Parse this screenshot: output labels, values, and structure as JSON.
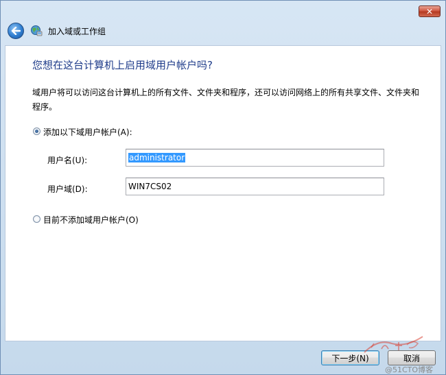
{
  "window": {
    "close_glyph": "✕"
  },
  "nav": {
    "title": "加入域或工作组",
    "back_icon": "back-arrow-icon",
    "title_icon": "network-globe-icon"
  },
  "page": {
    "heading": "您想在这台计算机上启用域用户帐户吗?",
    "description": "域用户将可以访问这台计算机上的所有文件、文件夹和程序，还可以访问网络上的所有共享文件、文件夹和程序。",
    "options": {
      "add": {
        "label": "添加以下域用户帐户(A):",
        "checked": true
      },
      "none": {
        "label": "目前不添加域用户帐户(O)",
        "checked": false
      }
    },
    "fields": {
      "username_label": "用户名(U):",
      "username_value": "administrator",
      "domain_label": "用户域(D):",
      "domain_value": "WIN7CS02"
    }
  },
  "footer": {
    "next_label": "下一步(N)",
    "cancel_label": "取消"
  },
  "watermark": {
    "text": "@51CTO博客"
  },
  "colors": {
    "heading": "#1f3c8a",
    "selection": "#3399ff"
  }
}
